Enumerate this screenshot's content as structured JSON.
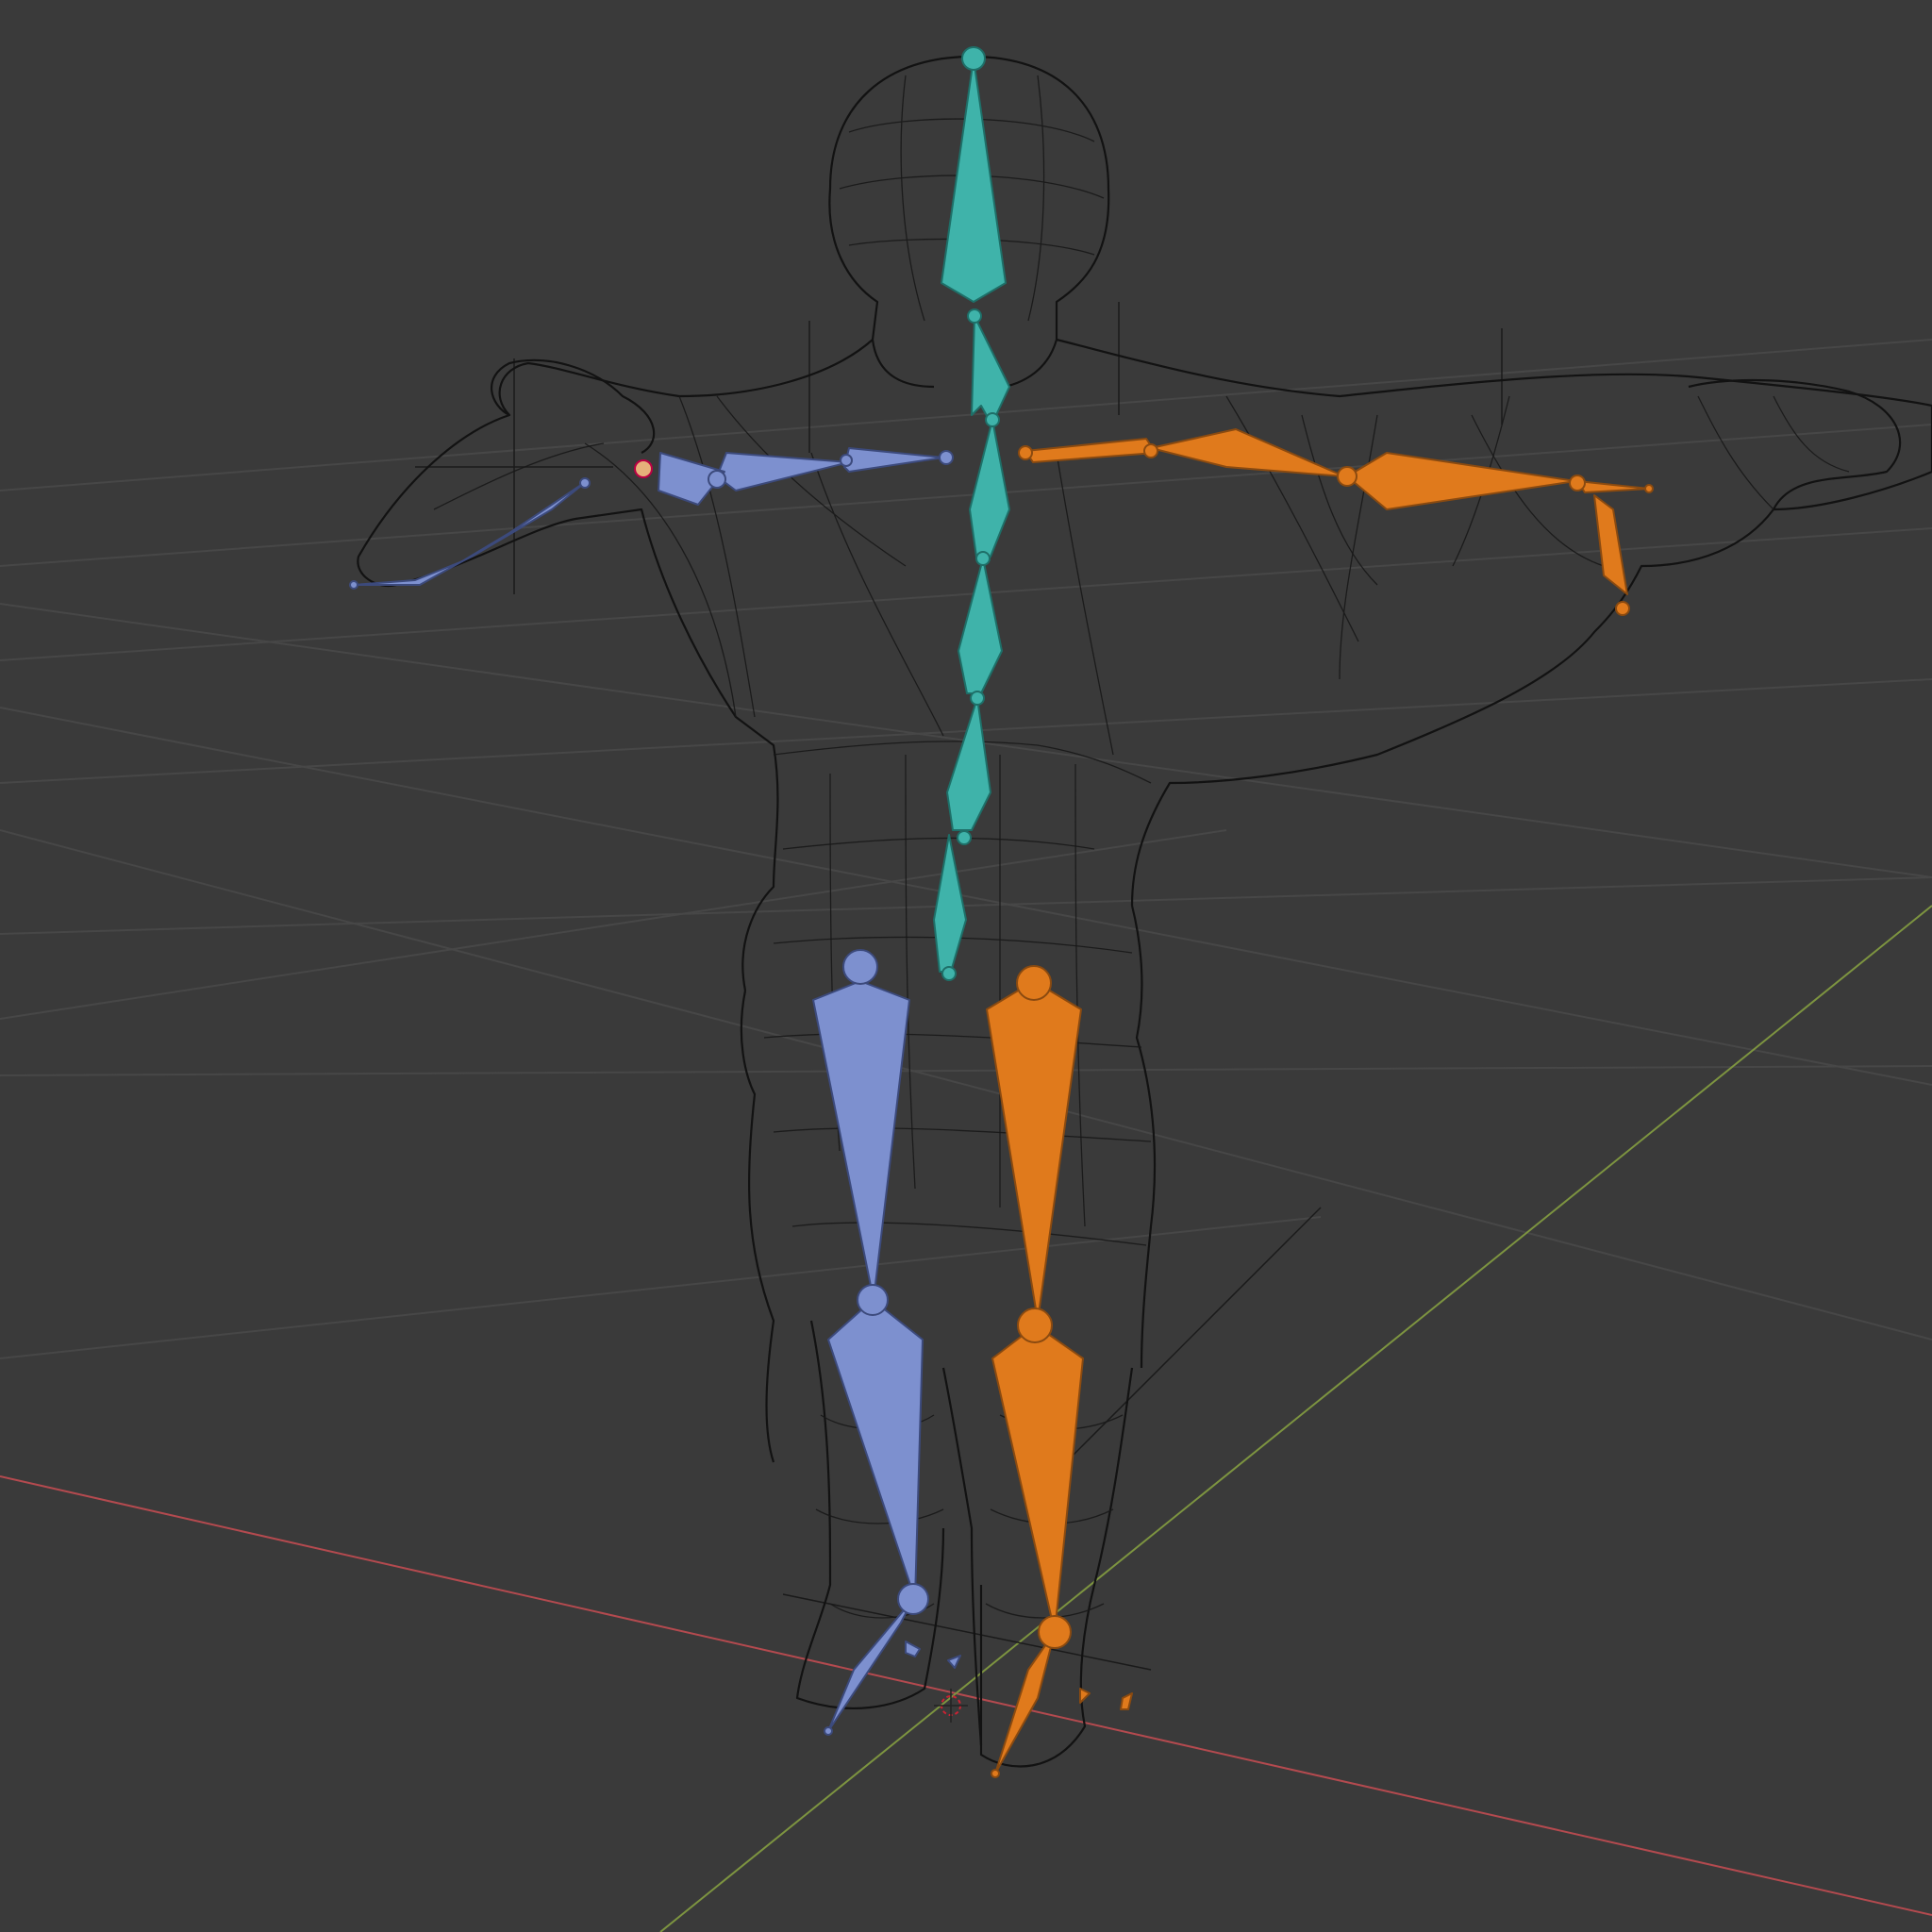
{
  "app": {
    "view": "3D Viewport",
    "mode": "wireframe"
  },
  "colors": {
    "background": "#3a3a3a",
    "grid": "#474747",
    "axis_x": "#b44a4f",
    "axis_y": "#7d9440",
    "mesh_wire": "#121212",
    "bone_center": "#3fb3aa",
    "bone_left": "#7d90cf",
    "bone_right": "#e07a1c"
  },
  "armature": {
    "groups": [
      {
        "name": "center",
        "color": "bone_center"
      },
      {
        "name": "left",
        "color": "bone_left"
      },
      {
        "name": "right",
        "color": "bone_right"
      }
    ]
  },
  "icons": [
    "3d-cursor-icon",
    "empty-cross-icon"
  ]
}
